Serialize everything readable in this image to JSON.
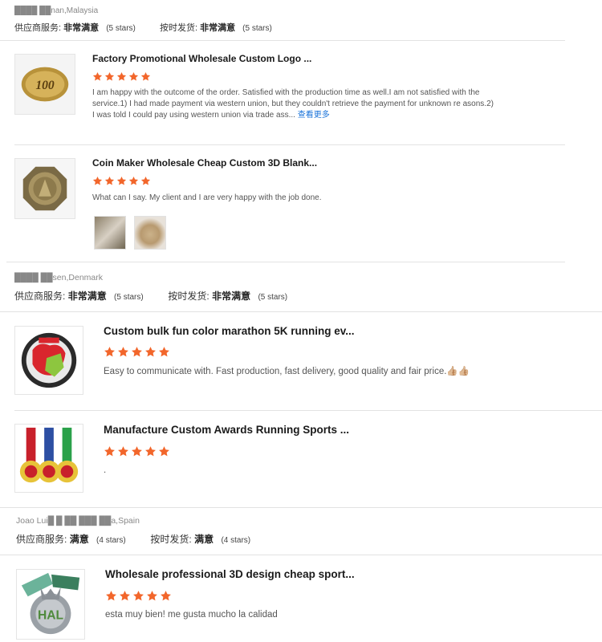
{
  "labels": {
    "supplier_service": "供应商服务:",
    "on_time": "按时发货:"
  },
  "sections": [
    {
      "reviewer": "████ ██nan,Malaysia",
      "supplier_value": "非常满意",
      "supplier_count": "(5 stars)",
      "shipping_value": "非常满意",
      "shipping_count": "(5 stars)",
      "reviews": [
        {
          "title": "Factory Promotional Wholesale Custom Logo ...",
          "stars": 5,
          "thumb_icon": "gold-coin-100-icon",
          "text": "I am happy with the outcome of the order. Satisfied with the production time as well.I am not satisfied with the service.1) I had made payment via western union, but they couldn't retrieve the payment for unknown re asons.2) I was told I could pay using western union via trade ass...",
          "more": "查看更多"
        },
        {
          "title": "Coin Maker Wholesale Cheap Custom 3D Blank...",
          "stars": 5,
          "thumb_icon": "bronze-octagon-coin-icon",
          "text": "What can I say. My client and I are very happy with the job done."
        }
      ]
    },
    {
      "reviewer": "████ ██sen,Denmark",
      "supplier_value": "非常满意",
      "supplier_count": "(5 stars)",
      "shipping_value": "非常满意",
      "shipping_count": "(5 stars)",
      "reviews": [
        {
          "title": "Custom bulk fun color marathon 5K running ev...",
          "stars": 5,
          "thumb_icon": "marathon-medal-icon",
          "text": "Easy to communicate with. Fast production, fast delivery, good quality and fair price.👍🏼👍🏼"
        },
        {
          "title": "Manufacture Custom Awards Running Sports ...",
          "stars": 5,
          "thumb_icon": "three-medals-icon",
          "text": "."
        }
      ]
    },
    {
      "reviewer": "Joao Lui█ █ ██ ███ ██a,Spain",
      "supplier_value": "满意",
      "supplier_count": "(4 stars)",
      "shipping_value": "满意",
      "shipping_count": "(4 stars)",
      "reviews": [
        {
          "title": "Wholesale professional 3D design cheap sport...",
          "stars": 5,
          "thumb_icon": "3d-sport-medal-icon",
          "text": "esta muy bien!  me gusta mucho la calidad"
        }
      ]
    }
  ],
  "colors": {
    "star": "#f2662b",
    "link": "#1a73d9",
    "divider": "#e2e2e2"
  }
}
